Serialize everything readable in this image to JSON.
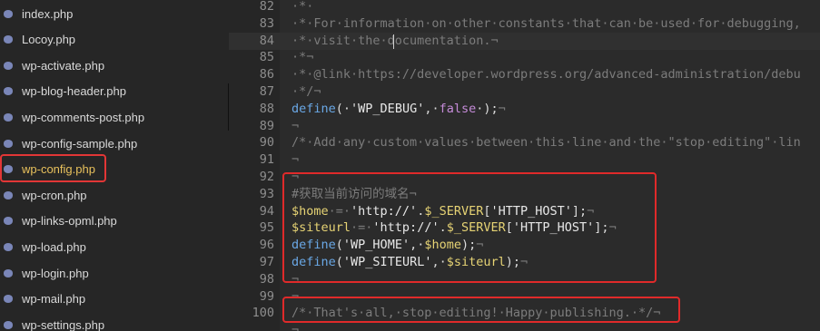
{
  "sidebar": {
    "files": [
      {
        "label": "index.php"
      },
      {
        "label": "Locoy.php"
      },
      {
        "label": "wp-activate.php"
      },
      {
        "label": "wp-blog-header.php"
      },
      {
        "label": "wp-comments-post.php"
      },
      {
        "label": "wp-config-sample.php"
      },
      {
        "label": "wp-config.php",
        "highlighted": true
      },
      {
        "label": "wp-cron.php"
      },
      {
        "label": "wp-links-opml.php"
      },
      {
        "label": "wp-load.php"
      },
      {
        "label": "wp-login.php"
      },
      {
        "label": "wp-mail.php"
      },
      {
        "label": "wp-settings.php"
      }
    ]
  },
  "editor": {
    "current_line": "84",
    "lines": [
      {
        "no": "82",
        "segments": [
          {
            "t": "·*·",
            "c": "comment"
          }
        ]
      },
      {
        "no": "83",
        "segments": [
          {
            "t": "·*·For·information·on·other·constants·that·can·be·used·for·debugging,",
            "c": "comment"
          }
        ]
      },
      {
        "no": "84",
        "segments": [
          {
            "t": "·*·visit·the·documentation.¬",
            "c": "comment"
          }
        ]
      },
      {
        "no": "85",
        "segments": [
          {
            "t": "·*¬",
            "c": "comment"
          }
        ]
      },
      {
        "no": "86",
        "segments": [
          {
            "t": "·*·@link·https://developer.wordpress.org/advanced-administration/debu",
            "c": "comment"
          }
        ]
      },
      {
        "no": "87",
        "segments": [
          {
            "t": "·*/¬",
            "c": "comment"
          }
        ]
      },
      {
        "no": "88",
        "segments": [
          {
            "t": "define",
            "c": "func"
          },
          {
            "t": "(·",
            "c": "plain"
          },
          {
            "t": "'WP_DEBUG'",
            "c": "string"
          },
          {
            "t": ",·",
            "c": "plain"
          },
          {
            "t": "false",
            "c": "bool"
          },
          {
            "t": "·);",
            "c": "plain"
          },
          {
            "t": "¬",
            "c": "comment"
          }
        ]
      },
      {
        "no": "89",
        "segments": [
          {
            "t": "¬",
            "c": "comment"
          }
        ]
      },
      {
        "no": "90",
        "segments": [
          {
            "t": "/*·Add·any·custom·values·between·this·line·and·the·\"stop·editing\"·lin",
            "c": "comment"
          }
        ]
      },
      {
        "no": "91",
        "segments": [
          {
            "t": "¬",
            "c": "comment"
          }
        ]
      },
      {
        "no": "92",
        "segments": [
          {
            "t": "¬",
            "c": "comment"
          }
        ]
      },
      {
        "no": "93",
        "segments": [
          {
            "t": "#获取当前访问的域名¬",
            "c": "comment"
          }
        ]
      },
      {
        "no": "94",
        "segments": [
          {
            "t": "$home",
            "c": "var"
          },
          {
            "t": "·=·",
            "c": "comment"
          },
          {
            "t": "'http://'",
            "c": "string"
          },
          {
            "t": ".",
            "c": "plain"
          },
          {
            "t": "$_SERVER",
            "c": "var"
          },
          {
            "t": "[",
            "c": "plain"
          },
          {
            "t": "'HTTP_HOST'",
            "c": "string"
          },
          {
            "t": "];",
            "c": "plain"
          },
          {
            "t": "¬",
            "c": "comment"
          }
        ]
      },
      {
        "no": "95",
        "segments": [
          {
            "t": "$siteurl",
            "c": "var"
          },
          {
            "t": "·=·",
            "c": "comment"
          },
          {
            "t": "'http://'",
            "c": "string"
          },
          {
            "t": ".",
            "c": "plain"
          },
          {
            "t": "$_SERVER",
            "c": "var"
          },
          {
            "t": "[",
            "c": "plain"
          },
          {
            "t": "'HTTP_HOST'",
            "c": "string"
          },
          {
            "t": "];",
            "c": "plain"
          },
          {
            "t": "¬",
            "c": "comment"
          }
        ]
      },
      {
        "no": "96",
        "segments": [
          {
            "t": "define",
            "c": "func"
          },
          {
            "t": "(",
            "c": "plain"
          },
          {
            "t": "'WP_HOME'",
            "c": "string"
          },
          {
            "t": ",·",
            "c": "plain"
          },
          {
            "t": "$home",
            "c": "var"
          },
          {
            "t": ");",
            "c": "plain"
          },
          {
            "t": "¬",
            "c": "comment"
          }
        ]
      },
      {
        "no": "97",
        "segments": [
          {
            "t": "define",
            "c": "func"
          },
          {
            "t": "(",
            "c": "plain"
          },
          {
            "t": "'WP_SITEURL'",
            "c": "string"
          },
          {
            "t": ",·",
            "c": "plain"
          },
          {
            "t": "$siteurl",
            "c": "var"
          },
          {
            "t": ");",
            "c": "plain"
          },
          {
            "t": "¬",
            "c": "comment"
          }
        ]
      },
      {
        "no": "98",
        "segments": [
          {
            "t": "¬",
            "c": "comment"
          }
        ]
      },
      {
        "no": "99",
        "segments": [
          {
            "t": "¬",
            "c": "comment"
          }
        ]
      },
      {
        "no": "100",
        "segments": [
          {
            "t": "/*·That's·all,·stop·editing!·Happy·publishing.·*/¬",
            "c": "comment"
          }
        ]
      },
      {
        "no": "",
        "segments": [
          {
            "t": "¬",
            "c": "comment"
          }
        ]
      }
    ]
  },
  "colors": {
    "highlight_box": "#e02a2a",
    "selected_file_text": "#e8c15c",
    "comment": "#7c7c7c",
    "function": "#6aa8e6",
    "variable": "#e6d374",
    "boolean": "#c58bd8"
  },
  "icons": {
    "file_icon": "php-elephant-icon",
    "collapse_icon": "chevron-left-icon"
  }
}
